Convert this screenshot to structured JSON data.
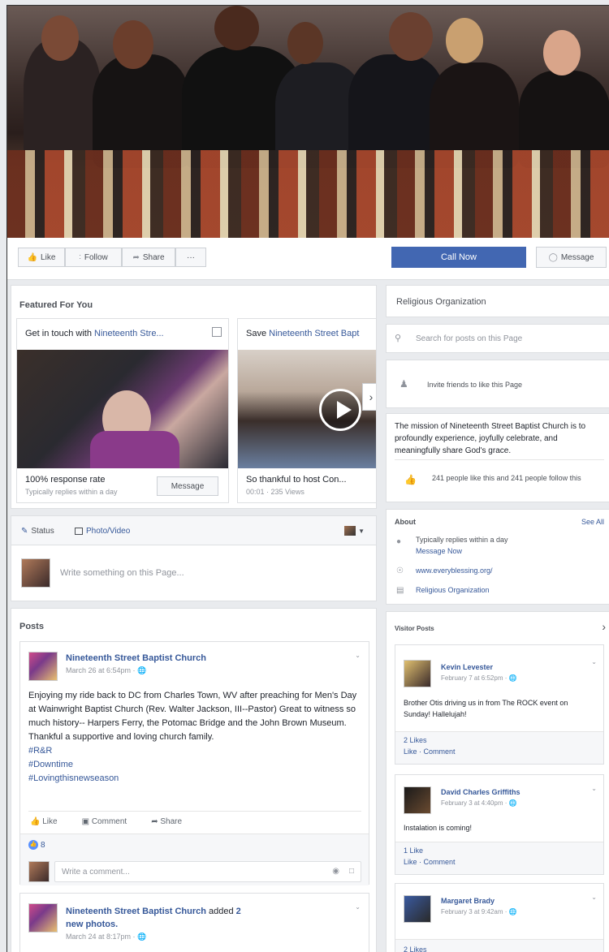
{
  "actions": {
    "like": "Like",
    "follow": "Follow",
    "share": "Share",
    "more": "···",
    "call_now": "Call Now",
    "message": "Message"
  },
  "featured": {
    "title": "Featured For You",
    "card1": {
      "prefix": "Get in touch with ",
      "link": "Nineteenth Stre...",
      "stat": "100% response rate",
      "sub": "Typically replies within a day",
      "button": "Message"
    },
    "card2": {
      "prefix": "Save ",
      "link": "Nineteenth Street Bapt",
      "caption": "So thankful to host Con...",
      "sub": "00:01 · 235 Views"
    }
  },
  "composer": {
    "status": "Status",
    "photo": "Photo/Video",
    "placeholder": "Write something on this Page..."
  },
  "posts": {
    "title": "Posts",
    "post1": {
      "author": "Nineteenth Street Baptist Church",
      "time": "March 26 at 6:54pm · ",
      "body": "Enjoying my ride back to DC from Charles Town, WV after preaching for Men's Day at Wainwright Baptist Church (Rev. Walter Jackson, III--Pastor) Great to witness so much history-- Harpers Ferry, the Potomac Bridge and the John Brown Museum. Thankful a supportive and loving church family.",
      "tags": [
        "#R&R",
        "#Downtime",
        "#Lovingthisnewseason"
      ],
      "like": "Like",
      "comment": "Comment",
      "share": "Share",
      "reactions": "8",
      "comment_placeholder": "Write a comment..."
    },
    "post2": {
      "author": "Nineteenth Street Baptist Church",
      "added": " added ",
      "added_link": "2 new photos.",
      "time": "March 24 at 8:17pm · "
    }
  },
  "sidebar": {
    "category": "Religious Organization",
    "search_placeholder": "Search for posts on this Page",
    "invite": "Invite friends to like this Page",
    "mission": "The mission of Nineteenth Street Baptist Church is to profoundly experience, joyfully celebrate, and meaningfully share God's grace.",
    "likes": "241 people like this and 241 people follow this",
    "about": {
      "title": "About",
      "see_all": "See All",
      "replies": "Typically replies within a day",
      "message_now": "Message Now",
      "website": "www.everyblessing.org/",
      "type": "Religious Organization"
    },
    "visitor": {
      "title": "Visitor Posts",
      "posts": [
        {
          "name": "Kevin Levester",
          "time": "February 7 at 6:52pm · ",
          "body": "Brother Otis driving us in from The ROCK event on Sunday! Hallelujah!",
          "likes": "2 Likes",
          "actions": "Like · Comment"
        },
        {
          "name": "David Charles Griffiths",
          "time": "February 3 at 4:40pm · ",
          "body": "Instalation is coming!",
          "likes": "1 Like",
          "actions": "Like · Comment"
        },
        {
          "name": "Margaret Brady",
          "time": "February 3 at 9:42am · ",
          "body": "",
          "likes": "2 Likes",
          "actions": ""
        }
      ]
    }
  }
}
